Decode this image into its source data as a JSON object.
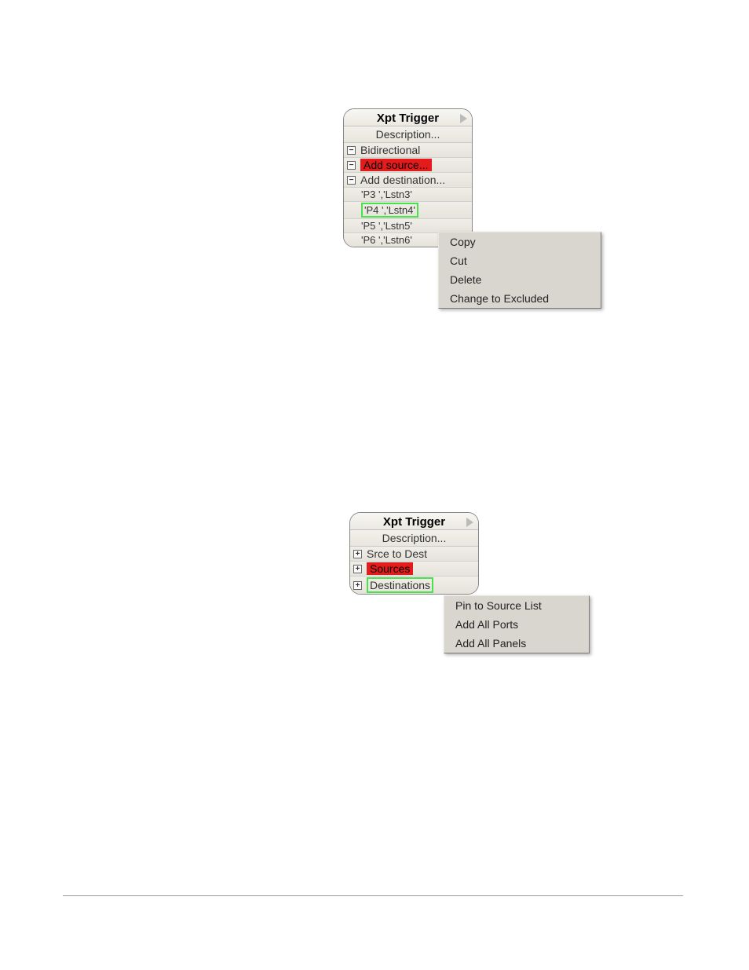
{
  "panel1": {
    "title": "Xpt Trigger",
    "description": "Description...",
    "rows": {
      "bidirectional": "Bidirectional",
      "add_source": "Add source...",
      "add_dest": "Add destination...",
      "children": [
        "'P3    ','Lstn3'",
        "'P4    ','Lstn4'",
        "'P5    ','Lstn5'",
        "'P6    ','Lstn6'"
      ]
    }
  },
  "ctxmenu1": {
    "items": [
      "Copy",
      "Cut",
      "Delete",
      "Change to Excluded"
    ]
  },
  "panel2": {
    "title": "Xpt Trigger",
    "description": "Description...",
    "rows": {
      "srce_to_dest": "Srce to Dest",
      "sources": "Sources",
      "destinations": "Destinations"
    }
  },
  "ctxmenu2": {
    "items": [
      "Pin to Source List",
      "Add All Ports",
      "Add All Panels"
    ]
  }
}
